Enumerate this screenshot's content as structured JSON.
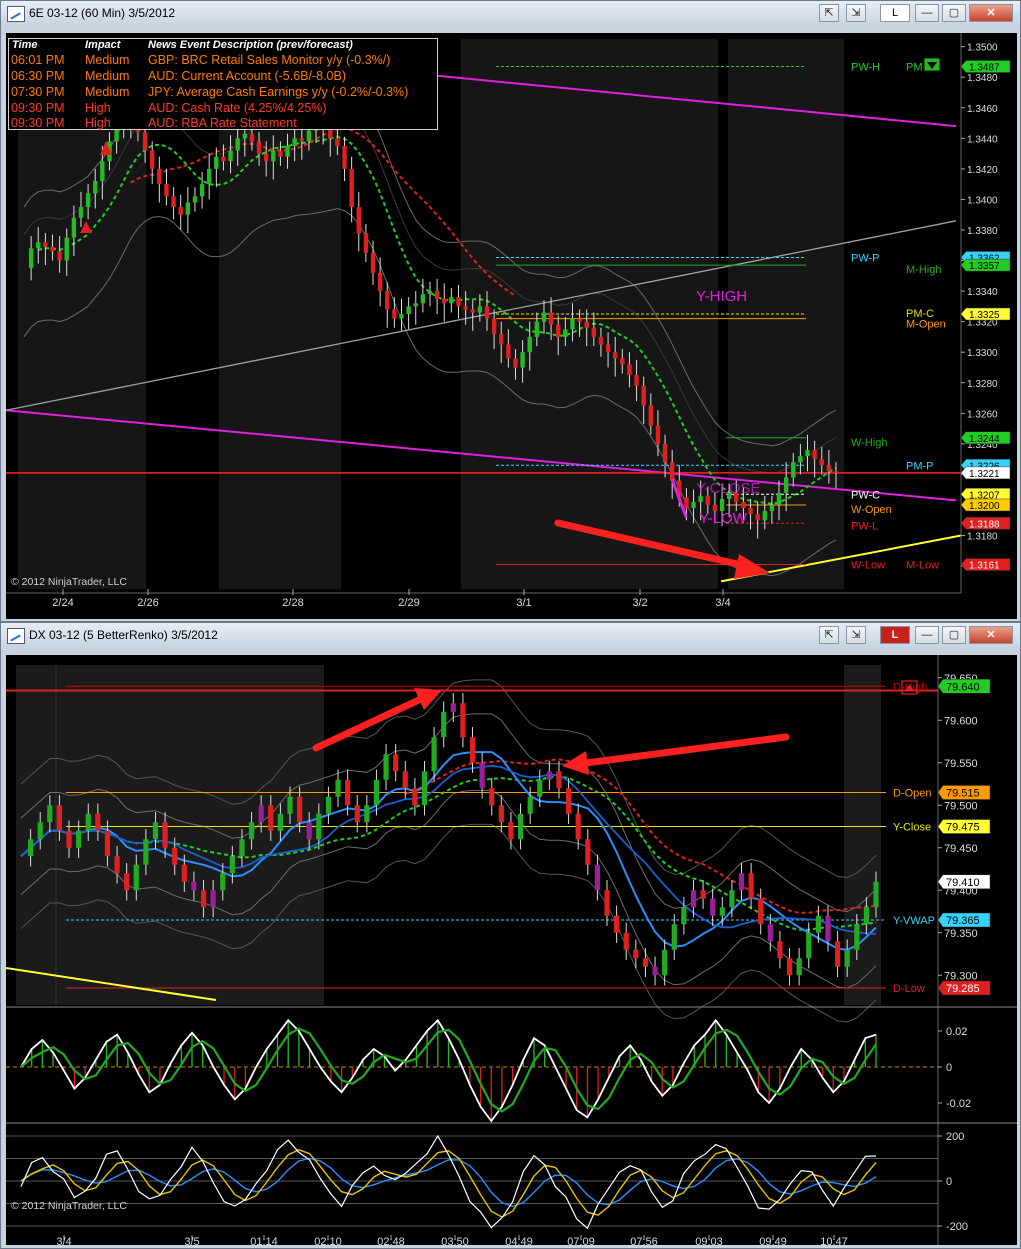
{
  "top_window": {
    "title": "6E 03-12 (60 Min)  3/5/2012",
    "l_button": "L",
    "min_label": "—",
    "max_label": "▢",
    "close_label": "✕",
    "copyright": "© 2012 NinjaTrader, LLC"
  },
  "news": {
    "headers": {
      "time": "Time",
      "impact": "Impact",
      "desc": "News Event Description (prev/forecast)"
    },
    "rows": [
      {
        "time": "06:01 PM",
        "impact": "Medium",
        "desc": "GBP: BRC Retail Sales Monitor y/y (-0.3%/)"
      },
      {
        "time": "06:30 PM",
        "impact": "Medium",
        "desc": "AUD: Current Account (-5.6B/-8.0B)"
      },
      {
        "time": "07:30 PM",
        "impact": "Medium",
        "desc": "JPY: Average Cash Earnings y/y (-0.2%/-0.3%)"
      },
      {
        "time": "09:30 PM",
        "impact": "High",
        "desc": "AUD: Cash Rate (4.25%/4.25%)"
      },
      {
        "time": "09:30 PM",
        "impact": "High",
        "desc": "AUD: RBA Rate Statement"
      }
    ]
  },
  "bottom_window": {
    "title": "DX 03-12 (5 BetterRenko)  3/5/2012",
    "l_button": "L",
    "min_label": "—",
    "max_label": "▢",
    "close_label": "✕",
    "copyright": "© 2012 NinjaTrader, LLC"
  },
  "chart_data": [
    {
      "type": "candlestick",
      "instrument": "6E 03-12 (60 Min)",
      "y_ticks": [
        "1.3500",
        "1.3480",
        "1.3460",
        "1.3440",
        "1.3420",
        "1.3400",
        "1.3380",
        "1.3360",
        "1.3340",
        "1.3320",
        "1.3300",
        "1.3280",
        "1.3260",
        "1.3240",
        "1.3220",
        "1.3200",
        "1.3180",
        "1.3160"
      ],
      "ylim": [
        1.3145,
        1.3505
      ],
      "x_tick_labels": [
        "2/24",
        "2/26",
        "2/28",
        "2/29",
        "3/1",
        "3/2",
        "3/4"
      ],
      "annotations": [
        "Y-HIGH",
        "Y-CLOSE",
        "Y-LOW"
      ],
      "level_labels": [
        {
          "text": "PW-H",
          "value": 1.3487,
          "color": "#22cc22"
        },
        {
          "text": "PM-H",
          "value": 1.3487,
          "color": "#22cc22"
        },
        {
          "text": "PW-P",
          "value": 1.3362,
          "color": "#35d4ff"
        },
        {
          "text": "M-High",
          "value": 1.3357,
          "color": "#22aa22"
        },
        {
          "text": "PM-C",
          "value": 1.3325,
          "color": "#e6e600"
        },
        {
          "text": "M-Open",
          "value": 1.3322,
          "color": "#ff9900"
        },
        {
          "text": "W-High",
          "value": 1.3244,
          "color": "#22aa22"
        },
        {
          "text": "PM-P",
          "value": 1.3226,
          "color": "#35d4ff"
        },
        {
          "text": "PW-C",
          "value": 1.3207,
          "color": "#ffffff"
        },
        {
          "text": "W-Open",
          "value": 1.32,
          "color": "#ff9900"
        },
        {
          "text": "PW-L",
          "value": 1.3188,
          "color": "#e02020"
        },
        {
          "text": "W-Low",
          "value": 1.3161,
          "color": "#e02020"
        },
        {
          "text": "M-Low",
          "value": 1.3161,
          "color": "#e02020"
        }
      ],
      "price_tags": [
        {
          "text": "1.3487",
          "value": 1.3487,
          "bg": "#22cc22",
          "fg": "#000000"
        },
        {
          "text": "1.3362",
          "value": 1.3362,
          "bg": "#35d4ff",
          "fg": "#000000"
        },
        {
          "text": "1.3357",
          "value": 1.3357,
          "bg": "#22cc22",
          "fg": "#000000"
        },
        {
          "text": "1.3325",
          "value": 1.3325,
          "bg": "#ffff33",
          "fg": "#000000"
        },
        {
          "text": "1.3244",
          "value": 1.3244,
          "bg": "#22cc22",
          "fg": "#000000"
        },
        {
          "text": "1.3226",
          "value": 1.3226,
          "bg": "#35d4ff",
          "fg": "#000000"
        },
        {
          "text": "1.3221",
          "value": 1.3221,
          "bg": "#ffffff",
          "fg": "#000000"
        },
        {
          "text": "1.3207",
          "value": 1.3207,
          "bg": "#ffff33",
          "fg": "#000000"
        },
        {
          "text": "1.3200",
          "value": 1.32,
          "bg": "#ffcc00",
          "fg": "#000000"
        },
        {
          "text": "1.3188",
          "value": 1.3188,
          "bg": "#e02020",
          "fg": "#ffffff"
        },
        {
          "text": "1.3161",
          "value": 1.3161,
          "bg": "#e02020",
          "fg": "#ffffff"
        }
      ],
      "close_series": [
        1.3355,
        1.3368,
        1.3372,
        1.3369,
        1.3366,
        1.336,
        1.3375,
        1.3388,
        1.3395,
        1.3404,
        1.3412,
        1.3425,
        1.3438,
        1.345,
        1.3455,
        1.3452,
        1.3444,
        1.3432,
        1.342,
        1.341,
        1.3402,
        1.3395,
        1.339,
        1.3398,
        1.3402,
        1.341,
        1.342,
        1.3428,
        1.3425,
        1.3432,
        1.344,
        1.3443,
        1.3438,
        1.343,
        1.3425,
        1.3432,
        1.3428,
        1.3435,
        1.344,
        1.3438,
        1.3445,
        1.345,
        1.3446,
        1.344,
        1.3435,
        1.342,
        1.3395,
        1.3378,
        1.3365,
        1.3352,
        1.334,
        1.3328,
        1.3322,
        1.3325,
        1.333,
        1.3332,
        1.3338,
        1.334,
        1.3335,
        1.3332,
        1.3336,
        1.333,
        1.3328,
        1.3326,
        1.333,
        1.3322,
        1.3312,
        1.3305,
        1.3296,
        1.329,
        1.33,
        1.331,
        1.332,
        1.3326,
        1.3318,
        1.331,
        1.3315,
        1.3322,
        1.332,
        1.3316,
        1.331,
        1.3305,
        1.33,
        1.3296,
        1.3292,
        1.3285,
        1.3278,
        1.3265,
        1.3252,
        1.324,
        1.3228,
        1.3216,
        1.3205,
        1.3198,
        1.3202,
        1.3206,
        1.32,
        1.3196,
        1.3204,
        1.3208,
        1.3202,
        1.3198,
        1.3194,
        1.319,
        1.3196,
        1.32,
        1.3208,
        1.3218,
        1.3228,
        1.3232,
        1.3236,
        1.323,
        1.3226,
        1.3222,
        1.3221
      ]
    },
    {
      "type": "candlestick",
      "instrument": "DX 03-12 (5 BetterRenko)",
      "y_ticks": [
        "79.650",
        "79.600",
        "79.550",
        "79.500",
        "79.450",
        "79.400",
        "79.350",
        "79.300"
      ],
      "ylim": [
        79.265,
        79.665
      ],
      "x_tick_labels": [
        "3/4",
        "3/5",
        "01:14",
        "02:10",
        "02:48",
        "03:50",
        "04:49",
        "07:09",
        "07:56",
        "09:03",
        "09:49",
        "10:47"
      ],
      "level_labels": [
        {
          "text": "D-High",
          "value": 79.64,
          "color": "#c80000"
        },
        {
          "text": "D-Open",
          "value": 79.515,
          "color": "#ff9900"
        },
        {
          "text": "Y-Close",
          "value": 79.475,
          "color": "#e6e600"
        },
        {
          "text": "Y-VWAP",
          "value": 79.365,
          "color": "#35d4ff"
        },
        {
          "text": "D-Low",
          "value": 79.285,
          "color": "#e02020"
        }
      ],
      "price_tags": [
        {
          "text": "79.640",
          "value": 79.64,
          "bg": "#22cc22",
          "fg": "#000000"
        },
        {
          "text": "79.515",
          "value": 79.515,
          "bg": "#ff9900",
          "fg": "#000000"
        },
        {
          "text": "79.475",
          "value": 79.475,
          "bg": "#ffff33",
          "fg": "#000000"
        },
        {
          "text": "79.410",
          "value": 79.41,
          "bg": "#ffffff",
          "fg": "#000000"
        },
        {
          "text": "79.365",
          "value": 79.365,
          "bg": "#35d4ff",
          "fg": "#000000"
        },
        {
          "text": "79.285",
          "value": 79.285,
          "bg": "#e02020",
          "fg": "#ffffff"
        }
      ],
      "close_series": [
        79.44,
        79.46,
        79.48,
        79.5,
        79.47,
        79.45,
        79.47,
        79.49,
        79.47,
        79.44,
        79.42,
        79.4,
        79.43,
        79.46,
        79.48,
        79.45,
        79.43,
        79.41,
        79.4,
        79.38,
        79.4,
        79.42,
        79.44,
        79.46,
        79.48,
        79.5,
        79.47,
        79.49,
        79.51,
        79.48,
        79.46,
        79.49,
        79.51,
        79.53,
        79.5,
        79.48,
        79.5,
        79.53,
        79.56,
        79.54,
        79.52,
        79.5,
        79.54,
        79.58,
        79.61,
        79.62,
        79.58,
        79.55,
        79.52,
        79.5,
        79.48,
        79.46,
        79.49,
        79.51,
        79.53,
        79.54,
        79.52,
        79.49,
        79.46,
        79.43,
        79.4,
        79.37,
        79.35,
        79.33,
        79.32,
        79.31,
        79.3,
        79.33,
        79.36,
        79.38,
        79.4,
        79.39,
        79.37,
        79.38,
        79.4,
        79.42,
        79.39,
        79.36,
        79.34,
        79.32,
        79.3,
        79.32,
        79.35,
        79.37,
        79.34,
        79.31,
        79.33,
        79.36,
        79.38,
        79.41
      ]
    },
    {
      "type": "histogram_oscillator",
      "y_ticks": [
        "0.02",
        "0",
        "-0.02"
      ],
      "ylim": [
        -0.03,
        0.03
      ],
      "values": [
        0.0,
        0.01,
        0.015,
        0.008,
        -0.002,
        -0.012,
        -0.006,
        0.004,
        0.014,
        0.018,
        0.008,
        -0.004,
        -0.014,
        -0.01,
        0.002,
        0.012,
        0.019,
        0.012,
        0.0,
        -0.01,
        -0.018,
        -0.012,
        0.0,
        0.01,
        0.018,
        0.026,
        0.02,
        0.01,
        0.0,
        -0.008,
        -0.014,
        -0.006,
        0.004,
        0.01,
        0.006,
        -0.002,
        0.004,
        0.012,
        0.02,
        0.026,
        0.016,
        0.004,
        -0.01,
        -0.022,
        -0.03,
        -0.022,
        -0.01,
        0.004,
        0.016,
        0.012,
        0.0,
        -0.012,
        -0.024,
        -0.028,
        -0.018,
        -0.006,
        0.006,
        0.012,
        0.004,
        -0.008,
        -0.016,
        -0.01,
        0.002,
        0.012,
        0.018,
        0.026,
        0.018,
        0.008,
        -0.002,
        -0.014,
        -0.02,
        -0.012,
        0.0,
        0.01,
        0.004,
        -0.006,
        -0.014,
        -0.008,
        0.004,
        0.016,
        0.018
      ]
    },
    {
      "type": "line_oscillator",
      "y_ticks": [
        "200",
        "0",
        "-200"
      ],
      "ylim": [
        -240,
        240
      ]
    }
  ]
}
